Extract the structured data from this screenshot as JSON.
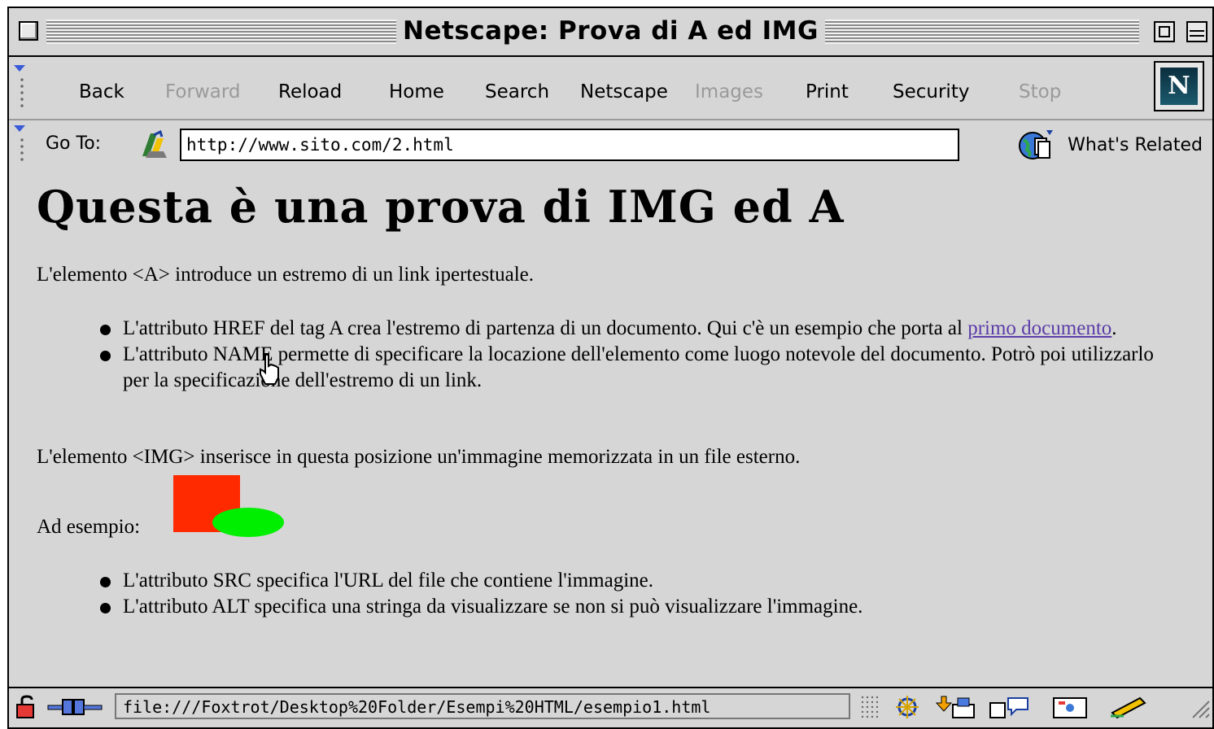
{
  "window": {
    "title": "Netscape: Prova di A ed IMG"
  },
  "toolbar": {
    "buttons": [
      {
        "label": "Back",
        "enabled": true
      },
      {
        "label": "Forward",
        "enabled": false
      },
      {
        "label": "Reload",
        "enabled": true
      },
      {
        "label": "Home",
        "enabled": true
      },
      {
        "label": "Search",
        "enabled": true
      },
      {
        "label": "Netscape",
        "enabled": true
      },
      {
        "label": "Images",
        "enabled": false
      },
      {
        "label": "Print",
        "enabled": true
      },
      {
        "label": "Security",
        "enabled": true
      },
      {
        "label": "Stop",
        "enabled": false
      }
    ],
    "logo": "N"
  },
  "location": {
    "label": "Go To:",
    "url": "http://www.sito.com/2.html",
    "related_label": "What's Related"
  },
  "content": {
    "heading": "Questa è una prova di IMG ed A",
    "intro_a": "L'elemento <A> introduce un estremo di un link ipertestuale.",
    "list_a": {
      "item1_prefix": "L'attributo HREF del tag A crea l'estremo di partenza di un documento. Qui c'è un esempio che porta al ",
      "item1_link": "primo documento",
      "item1_suffix": ".",
      "item2": "L'attributo NAME permette di specificare la locazione dell'elemento come luogo notevole del documento. Potrò poi utilizzarlo per la specificazione dell'estremo di un link."
    },
    "intro_img": "L'elemento <IMG> inserisce in questa posizione un'immagine memorizzata in un file esterno.",
    "example_label": "Ad esempio:",
    "list_img": {
      "item1": "L'attributo SRC specifica l'URL del file che contiene l'immagine.",
      "item2": "L'attributo ALT specifica una stringa da visualizzare se non si può visualizzare l'immagine."
    }
  },
  "status": {
    "text": "file:///Foxtrot/Desktop%20Folder/Esempi%20HTML/esempio1.html"
  },
  "colors": {
    "window_bg": "#d6d6d6",
    "link": "#5b3ca8",
    "demo_square": "#ff2a00",
    "demo_ellipse": "#00ee00"
  }
}
